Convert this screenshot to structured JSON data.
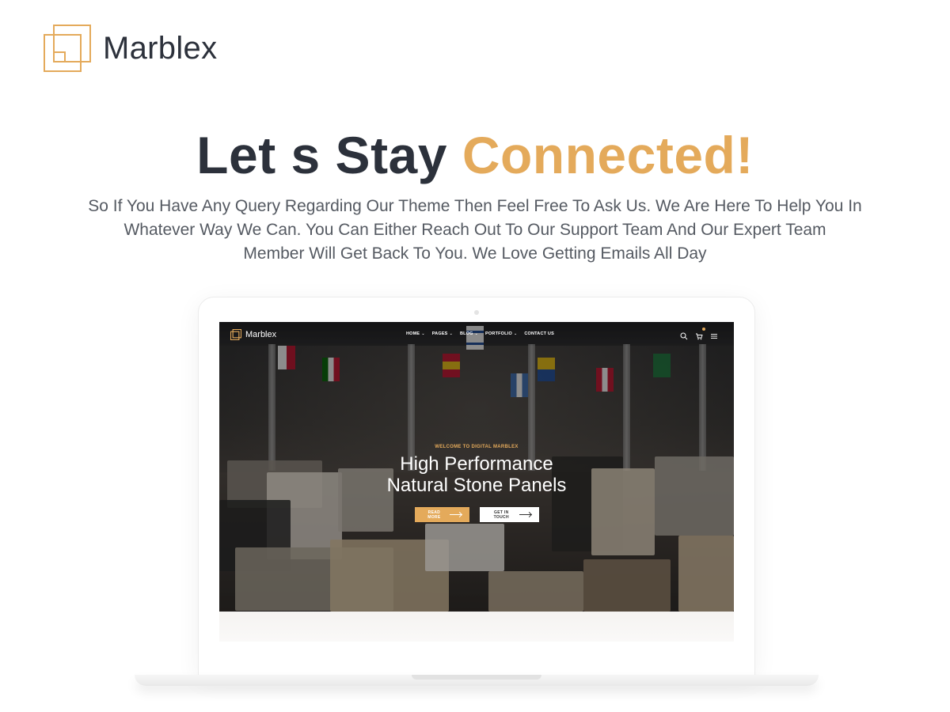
{
  "brand": {
    "name": "Marblex",
    "logo_icon": "overlapping-squares-logo-icon",
    "accent_color": "#e4aa5b"
  },
  "headline": {
    "main": "Let s Stay ",
    "accent": "Connected!"
  },
  "intro_lines": [
    "So If You Have Any Query Regarding Our Theme Then Feel Free To Ask Us. We Are Here To Help You In",
    "Whatever Way We Can. You Can Either Reach Out To Our Support Team And Our Expert Team",
    "Member Will Get Back To You. We Love Getting Emails All Day"
  ],
  "preview": {
    "brand_name": "Marblex",
    "nav": [
      {
        "label": "HOME",
        "has_dropdown": true
      },
      {
        "label": "PAGES",
        "has_dropdown": true
      },
      {
        "label": "BLOG",
        "has_dropdown": true
      },
      {
        "label": "PORTFOLIO",
        "has_dropdown": true
      },
      {
        "label": "CONTACT US",
        "has_dropdown": false
      }
    ],
    "icons": [
      "search-icon",
      "cart-icon",
      "menu-icon"
    ],
    "hero": {
      "eyebrow": "WELCOME TO DIGITAL MARBLEX",
      "title_line1": "High Performance",
      "title_line2": "Natural Stone Panels",
      "primary_button": "READ MORE",
      "secondary_button": "GET IN TOUCH"
    }
  }
}
